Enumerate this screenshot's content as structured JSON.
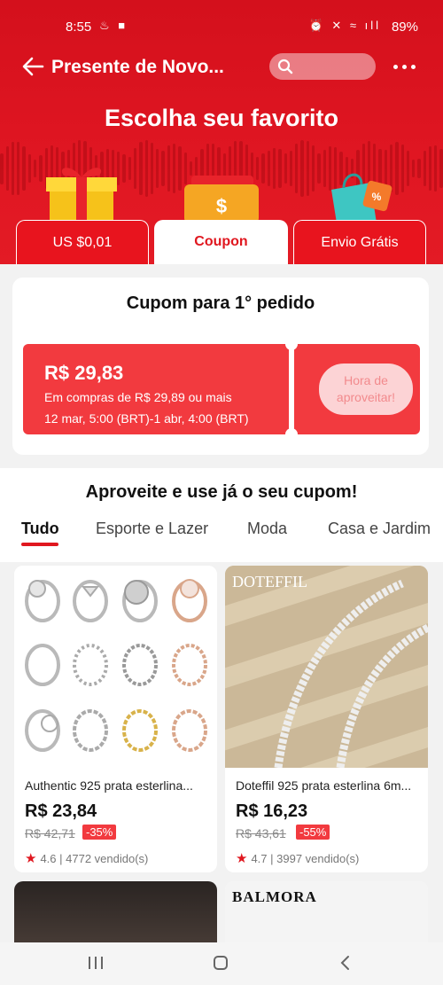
{
  "status_bar": {
    "time": "8:55",
    "left_icons": [
      "notification-icon",
      "video-icon"
    ],
    "right_icons": [
      "alarm-icon",
      "mute-icon",
      "wifi-icon",
      "signal-icon"
    ],
    "battery": "89%"
  },
  "header": {
    "title": "Presente de Novo...",
    "search_placeholder": "",
    "hero_title": "Escolha seu favorito"
  },
  "reward_tabs": [
    {
      "label": "US $0,01",
      "icon": "gift-box-icon"
    },
    {
      "label": "Coupon",
      "icon": "coupon-icon",
      "active": true
    },
    {
      "label": "Envio Grátis",
      "icon": "shopping-bag-icon"
    }
  ],
  "coupon": {
    "title": "Cupom para 1° pedido",
    "amount": "R$ 29,83",
    "condition": "Em compras de R$ 29,89 ou mais",
    "validity": "12 mar, 5:00 (BRT)-1 abr, 4:00 (BRT)",
    "button_line1": "Hora de",
    "button_line2": "aproveitar!"
  },
  "products_section": {
    "title": "Aproveite e use já o seu cupom!",
    "tabs": [
      "Tudo",
      "Esporte e Lazer",
      "Moda",
      "Casa e Jardim"
    ]
  },
  "products": [
    {
      "name": "Authentic 925 prata esterlina...",
      "price": "R$ 23,84",
      "old_price": "R$ 42,71",
      "discount": "-35%",
      "rating_text": "4.6 | 4772 vendido(s)"
    },
    {
      "name": "Doteffil 925 prata esterlina 6m...",
      "price": "R$ 16,23",
      "old_price": "R$ 43,61",
      "discount": "-55%",
      "rating_text": "4.7 | 3997 vendido(s)",
      "brand_watermark": "DOTEFFIL"
    },
    {
      "name": "",
      "image": "dark-photo"
    },
    {
      "name": "",
      "brand_watermark": "BALMORA"
    }
  ],
  "colors": {
    "brand_red": "#e0171f",
    "coupon_red": "#f23a3f"
  }
}
